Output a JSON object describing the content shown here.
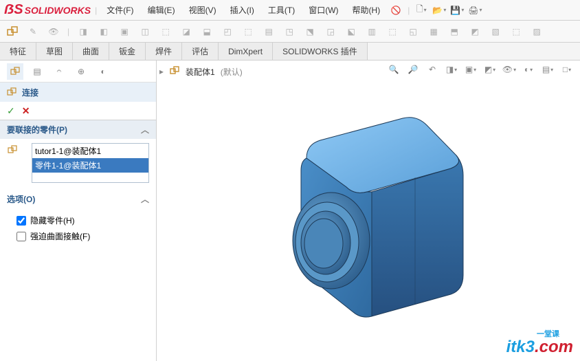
{
  "app": {
    "name": "SOLIDWORKS"
  },
  "menu": {
    "file": "文件(F)",
    "edit": "编辑(E)",
    "view": "视图(V)",
    "insert": "插入(I)",
    "tools": "工具(T)",
    "window": "窗口(W)",
    "help": "帮助(H)"
  },
  "cmd_tabs": {
    "features": "特征",
    "sketch": "草图",
    "surfaces": "曲面",
    "sheetmetal": "钣金",
    "weldments": "焊件",
    "evaluate": "评估",
    "dimxpert": "DimXpert",
    "addins": "SOLIDWORKS 插件"
  },
  "breadcrumb": {
    "root": "装配体1",
    "default": "(默认)"
  },
  "prop": {
    "title": "连接"
  },
  "sections": {
    "parts": {
      "title": "要联接的零件(P)",
      "items": [
        "tutor1-1@装配体1",
        "零件1-1@装配体1"
      ]
    },
    "options": {
      "title": "选项(O)",
      "hide": "隐藏零件(H)",
      "surface": "强迫曲面接触(F)",
      "hide_checked": true,
      "surface_checked": false
    }
  },
  "watermark": {
    "t1": "itk3",
    "t2": ".com",
    "sub": "一堂课"
  }
}
